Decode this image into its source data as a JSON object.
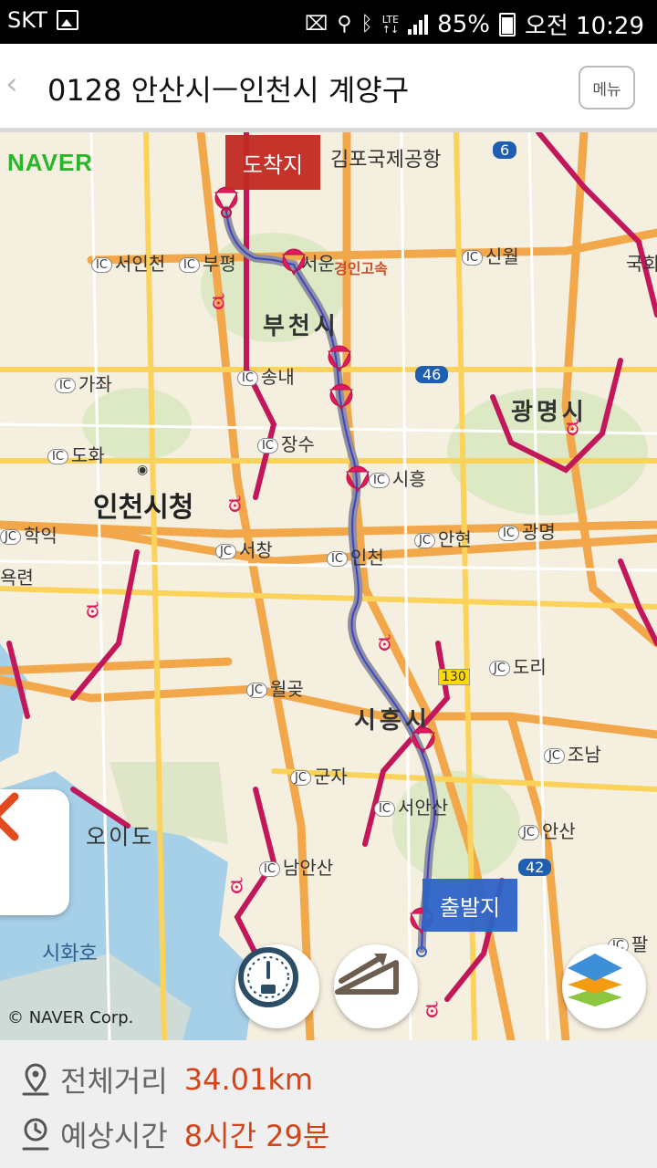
{
  "status_bar": {
    "carrier": "SKT",
    "battery": "85%",
    "time": "오전 10:29"
  },
  "header": {
    "back_icon": "‹",
    "title": "0128 안산시ㅡ인천시 계양구",
    "menu_label": "메뉴"
  },
  "map": {
    "logo": "NAVER",
    "copyright": "© NAVER Corp.",
    "destination_label": "도착지",
    "start_label": "출발지",
    "labels": {
      "gimpo_airport": "김포국제공항",
      "seoincheon": "서인천",
      "bupyeong": "부평",
      "seoun": "서운",
      "gyeongin": "경인고속",
      "sinwol": "신월",
      "gukhoe": "국회",
      "bucheon": "부천시",
      "gaja": "가좌",
      "songnae": "송내",
      "gwangmyeong": "광명시",
      "doha": "도화",
      "jangsu": "장수",
      "siheung_ic": "시흥",
      "incheon_cityhall": "인천시청",
      "hakik": "학익",
      "seochang": "서창",
      "incheon": "인천",
      "anhyeon": "안현",
      "gwangmyeong_ic": "광명",
      "oryeon": "욕련",
      "dori": "도리",
      "wolgot": "월곶",
      "siheung_city": "시흥시",
      "jonam": "조남",
      "gunja": "군자",
      "seoansan": "서안산",
      "oido": "오이도",
      "ansan": "안산",
      "namansan": "남안산",
      "sihwaho": "시화호",
      "pal": "팔",
      "road_num_6": "6",
      "road_num_46": "46",
      "road_num_42": "42",
      "road_num_130": "130"
    }
  },
  "summary": {
    "distance_label": "전체거리",
    "distance_value": "34.01km",
    "time_label": "예상시간",
    "time_value": "8시간 29분"
  }
}
